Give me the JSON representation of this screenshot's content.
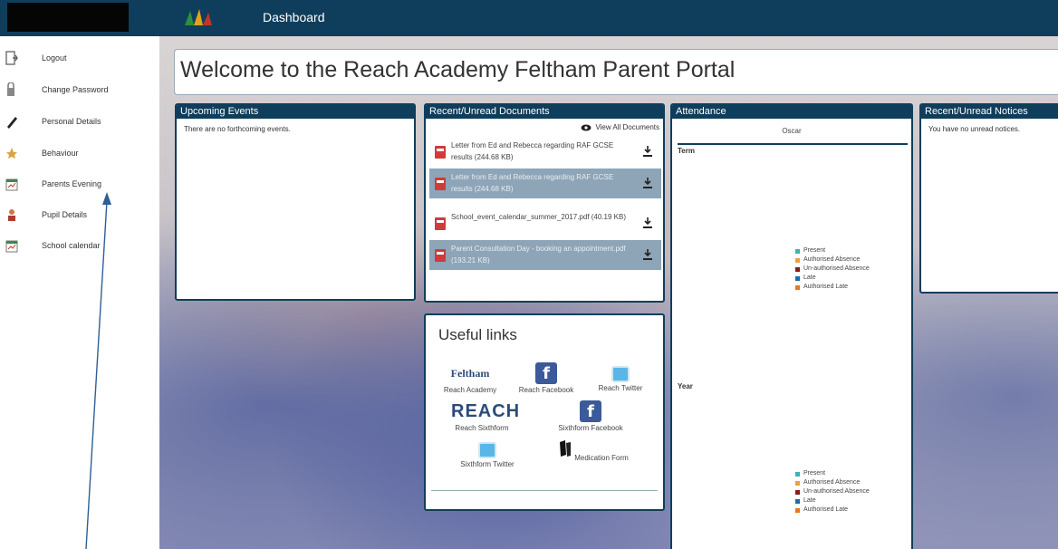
{
  "header": {
    "title": "Dashboard"
  },
  "sidebar": {
    "items": [
      {
        "label": "Logout",
        "icon": "logout-icon"
      },
      {
        "label": "Change Password",
        "icon": "key-icon"
      },
      {
        "label": "Personal Details",
        "icon": "pencil-icon"
      },
      {
        "label": "Behaviour",
        "icon": "star-icon"
      },
      {
        "label": "Parents Evening",
        "icon": "calendar-icon"
      },
      {
        "label": "Pupil Details",
        "icon": "person-icon"
      },
      {
        "label": "School calendar",
        "icon": "calendar-icon"
      }
    ]
  },
  "welcome": {
    "title": "Welcome to the Reach Academy Feltham Parent Portal"
  },
  "events": {
    "title": "Upcoming Events",
    "empty_text": "There are no forthcoming events."
  },
  "documents": {
    "title": "Recent/Unread Documents",
    "view_all": "View All Documents",
    "items": [
      {
        "text": "Letter from Ed and Rebecca regarding RAF GCSE results (244.68 KB)"
      },
      {
        "text": "Letter from Ed and Rebecca regarding RAF GCSE results (244.68 KB)"
      },
      {
        "text": "School_event_calendar_summer_2017.pdf (40.19 KB)"
      },
      {
        "text": "Parent Consultation Day - booking an appointment.pdf (193.21 KB)"
      }
    ]
  },
  "attendance": {
    "title": "Attendance",
    "student": "Oscar",
    "term_label": "Term",
    "year_label": "Year",
    "legend": [
      {
        "label": "Present",
        "color": "#3bb3b5"
      },
      {
        "label": "Authorised Absence",
        "color": "#e9a23b"
      },
      {
        "label": "Un-authorised Absence",
        "color": "#8b1a1a"
      },
      {
        "label": "Late",
        "color": "#1c6bb0"
      },
      {
        "label": "Authorised Late",
        "color": "#e8781c"
      }
    ]
  },
  "notices": {
    "title": "Recent/Unread Notices",
    "empty_text": "You have no unread notices."
  },
  "useful_links": {
    "title": "Useful links",
    "feltham_logo_text": "Feltham",
    "reach_logo_text": "REACH",
    "items": [
      {
        "label": "Reach Academy"
      },
      {
        "label": "Reach Facebook"
      },
      {
        "label": "Reach Twitter"
      },
      {
        "label": "Reach Sixthform"
      },
      {
        "label": "Sixthform Facebook"
      },
      {
        "label": "Sixthform Twitter"
      },
      {
        "label": "Medication Form"
      }
    ]
  }
}
